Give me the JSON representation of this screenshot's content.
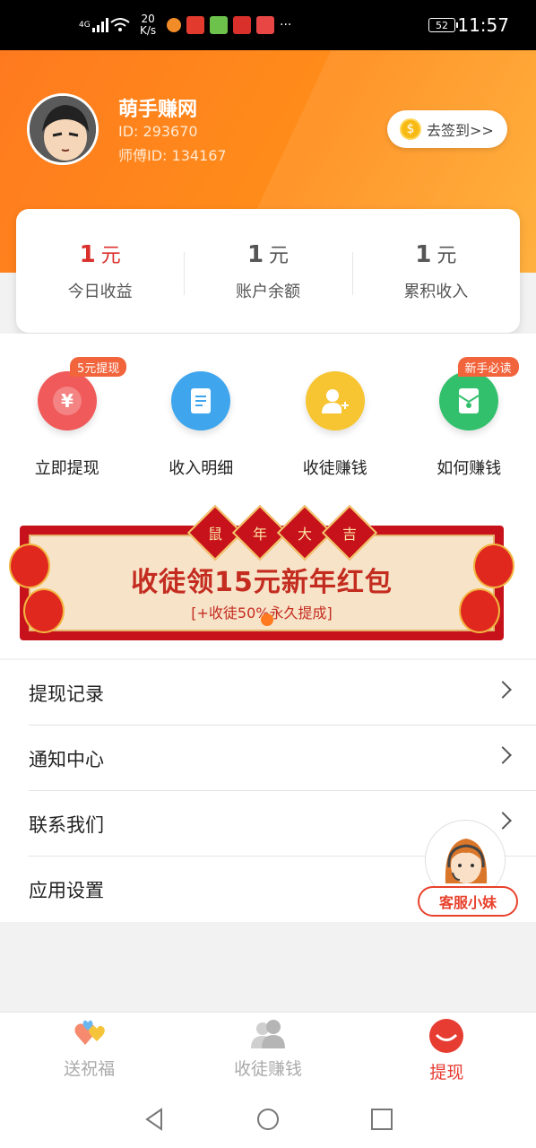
{
  "status_bar": {
    "network": "4G",
    "speed_value": "20",
    "speed_unit": "K/s",
    "more": "···",
    "battery": "52",
    "time": "11:57"
  },
  "profile": {
    "name": "萌手赚网",
    "id_text": "ID:  293670",
    "master_id_text": "师傅ID:  134167",
    "signin_label": "去签到>>"
  },
  "stats": [
    {
      "value": "1",
      "unit": "元",
      "label": "今日收益"
    },
    {
      "value": "1",
      "unit": "元",
      "label": "账户余额"
    },
    {
      "value": "1",
      "unit": "元",
      "label": "累积收入"
    }
  ],
  "menu": [
    {
      "label": "立即提现",
      "tag": "5元提现",
      "icon": "yuan-icon",
      "color": "#f05a5a"
    },
    {
      "label": "收入明细",
      "tag": "",
      "icon": "document-icon",
      "color": "#3fa6ee"
    },
    {
      "label": "收徒赚钱",
      "tag": "",
      "icon": "add-user-icon",
      "color": "#f7c531"
    },
    {
      "label": "如何赚钱",
      "tag": "新手必读",
      "icon": "envelope-icon",
      "color": "#32c06c"
    }
  ],
  "banner": {
    "chars": [
      "鼠",
      "年",
      "大",
      "吉"
    ],
    "title": "收徒领15元新年红包",
    "subtitle": "[+收徒50%永久提成]"
  },
  "list": [
    {
      "label": "提现记录"
    },
    {
      "label": "通知中心"
    },
    {
      "label": "联系我们"
    },
    {
      "label": "应用设置"
    }
  ],
  "service": {
    "label": "客服小妹"
  },
  "tabs": [
    {
      "label": "送祝福",
      "icon": "hearts-icon",
      "active": false
    },
    {
      "label": "收徒赚钱",
      "icon": "users-icon",
      "active": false
    },
    {
      "label": "提现",
      "icon": "withdraw-icon",
      "active": true
    }
  ],
  "colors": {
    "header_orange": "#ff7a1f",
    "accent_red": "#e63c32",
    "banner_red": "#c8121b"
  }
}
